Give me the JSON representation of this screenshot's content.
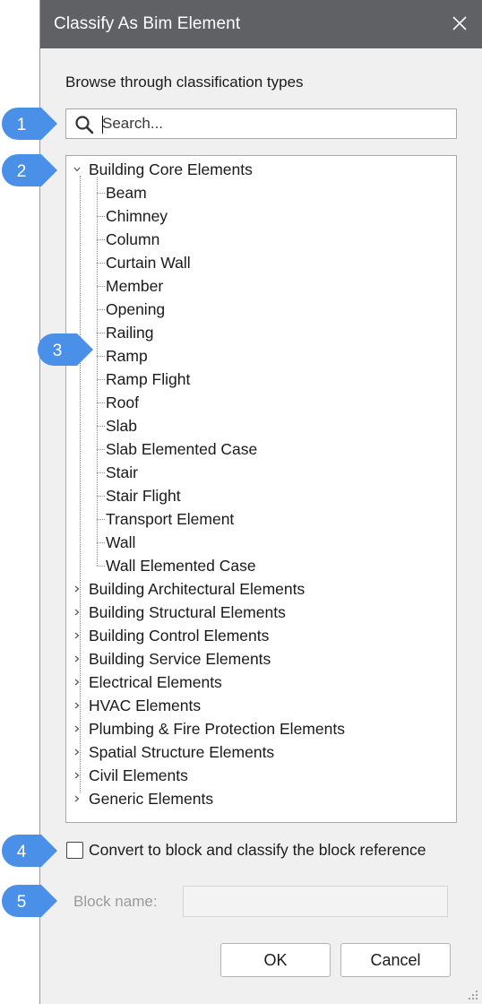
{
  "window": {
    "title": "Classify As Bim Element"
  },
  "prompt": "Browse through classification types",
  "search": {
    "placeholder": "Search...",
    "value": ""
  },
  "tree": {
    "root": {
      "label": "Building Core Elements",
      "expanded": true
    },
    "children": [
      "Beam",
      "Chimney",
      "Column",
      "Curtain Wall",
      "Member",
      "Opening",
      "Railing",
      "Ramp",
      "Ramp Flight",
      "Roof",
      "Slab",
      "Slab Elemented Case",
      "Stair",
      "Stair Flight",
      "Transport Element",
      "Wall",
      "Wall Elemented Case"
    ],
    "collapsed_groups": [
      "Building Architectural Elements",
      "Building Structural Elements",
      "Building Control Elements",
      "Building Service Elements",
      "Electrical Elements",
      "HVAC Elements",
      "Plumbing & Fire Protection Elements",
      "Spatial Structure Elements",
      "Civil Elements",
      "Generic Elements"
    ]
  },
  "convert": {
    "label": "Convert to block and classify the block reference",
    "checked": false
  },
  "block_name": {
    "label": "Block name:",
    "value": ""
  },
  "buttons": {
    "ok": "OK",
    "cancel": "Cancel"
  },
  "callouts": [
    "1",
    "2",
    "3",
    "4",
    "5"
  ],
  "colors": {
    "titlebar": "#5f6164",
    "callout": "#4a90e8",
    "dialog_bg": "#f0f0f0"
  }
}
